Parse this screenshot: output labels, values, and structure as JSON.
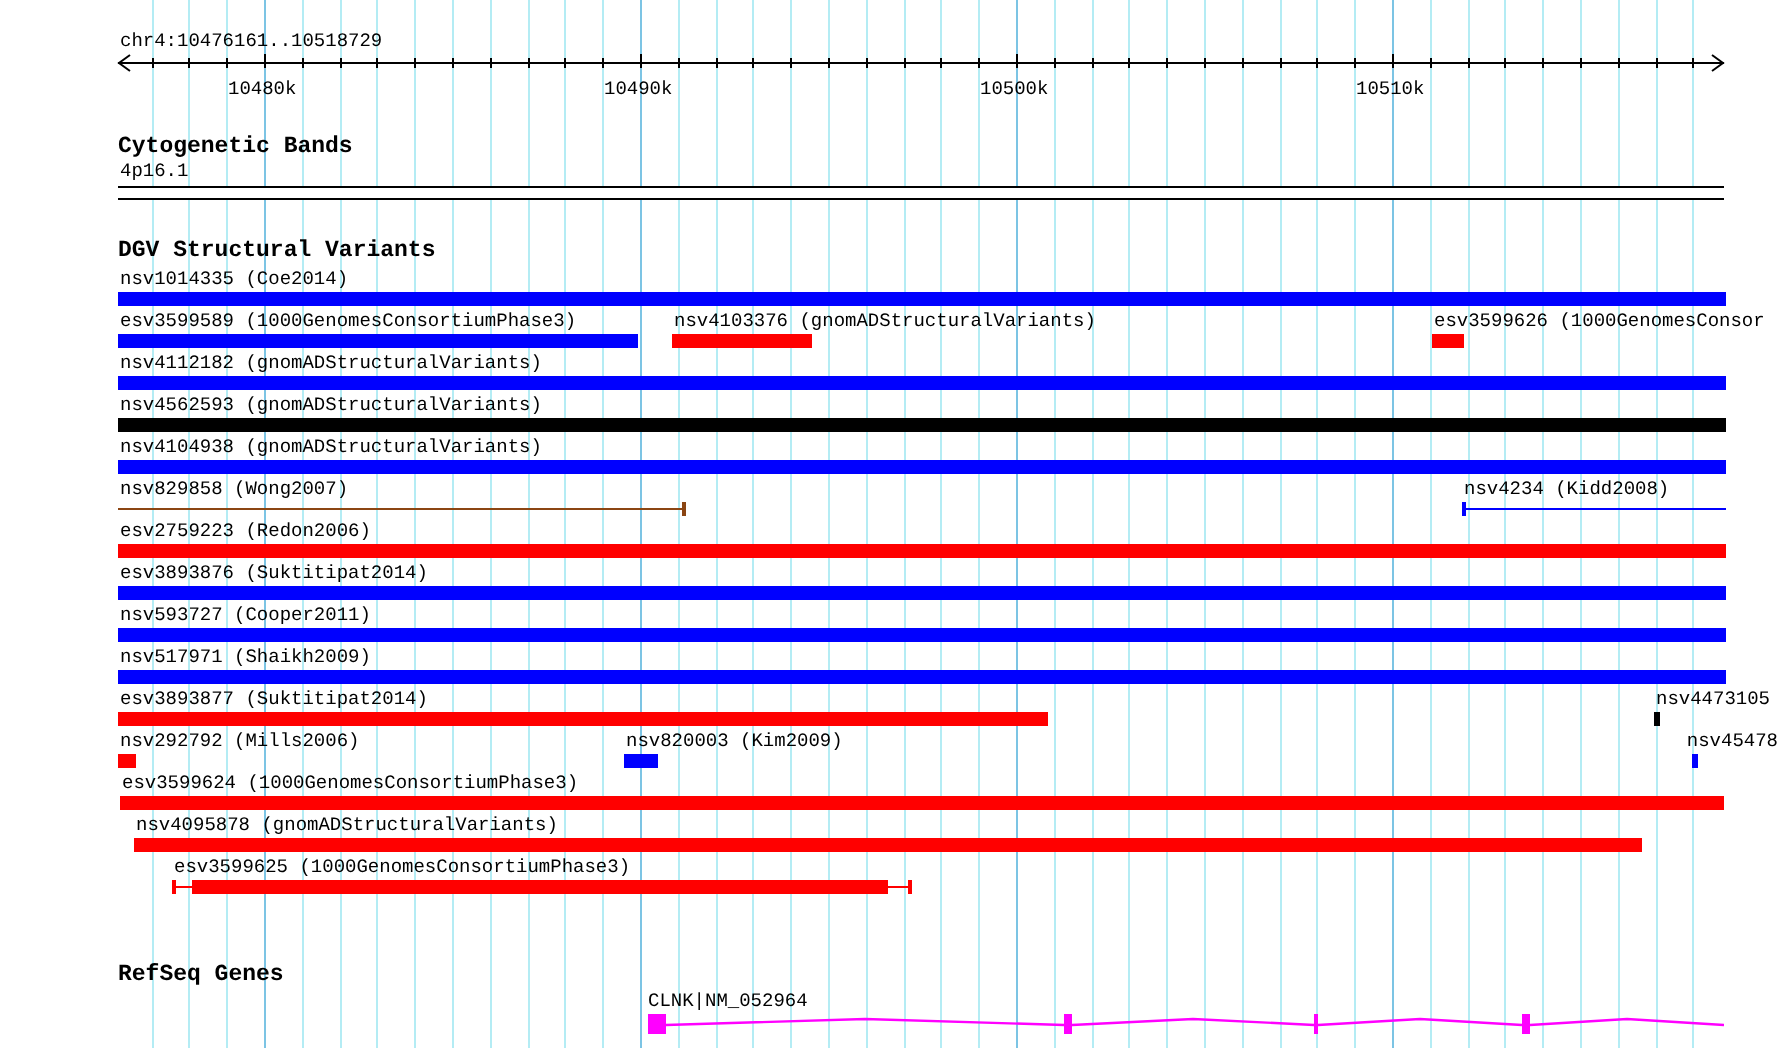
{
  "ruler": {
    "title": "chr4:10476161..10518729",
    "ticks": [
      {
        "label": "10480k"
      },
      {
        "label": "10490k"
      },
      {
        "label": "10500k"
      },
      {
        "label": "10510k"
      }
    ]
  },
  "tracks": [
    {
      "kind": "bands",
      "title": "Cytogenetic Bands",
      "bands": [
        {
          "label": "4p16.1"
        }
      ]
    },
    {
      "kind": "variants",
      "title": "DGV Structural Variants",
      "rows": [
        {
          "features": [
            {
              "label": "nsv1014335 (Coe2014)",
              "kind": "bar",
              "color": "#0000ff"
            }
          ]
        },
        {
          "features": [
            {
              "label": "esv3599589 (1000GenomesConsortiumPhase3)",
              "kind": "bar",
              "color": "#0000ff"
            },
            {
              "label": "nsv4103376 (gnomADStructuralVariants)",
              "kind": "bar",
              "color": "#ff0000"
            },
            {
              "label": "esv3599626 (1000GenomesConsor",
              "kind": "bar",
              "color": "#ff0000"
            }
          ]
        },
        {
          "features": [
            {
              "label": "nsv4112182 (gnomADStructuralVariants)",
              "kind": "bar",
              "color": "#0000ff"
            }
          ]
        },
        {
          "features": [
            {
              "label": "nsv4562593 (gnomADStructuralVariants)",
              "kind": "bar",
              "color": "#000000"
            }
          ]
        },
        {
          "features": [
            {
              "label": "nsv4104938 (gnomADStructuralVariants)",
              "kind": "bar",
              "color": "#0000ff"
            }
          ]
        },
        {
          "features": [
            {
              "label": "nsv829858 (Wong2007)",
              "kind": "line",
              "color": "#8b4513"
            },
            {
              "label": "nsv4234 (Kidd2008)",
              "kind": "line",
              "color": "#0000ff"
            }
          ]
        },
        {
          "features": [
            {
              "label": "esv2759223 (Redon2006)",
              "kind": "bar",
              "color": "#ff0000"
            }
          ]
        },
        {
          "features": [
            {
              "label": "esv3893876 (Suktitipat2014)",
              "kind": "bar",
              "color": "#0000ff"
            }
          ]
        },
        {
          "features": [
            {
              "label": "nsv593727 (Cooper2011)",
              "kind": "bar",
              "color": "#0000ff"
            }
          ]
        },
        {
          "features": [
            {
              "label": "nsv517971 (Shaikh2009)",
              "kind": "bar",
              "color": "#0000ff"
            }
          ]
        },
        {
          "features": [
            {
              "label": "esv3893877 (Suktitipat2014)",
              "kind": "bar",
              "color": "#ff0000"
            },
            {
              "label": "nsv4473105",
              "kind": "bar",
              "color": "#000000"
            }
          ]
        },
        {
          "features": [
            {
              "label": "nsv292792 (Mills2006)",
              "kind": "bar",
              "color": "#ff0000"
            },
            {
              "label": "nsv820003 (Kim2009)",
              "kind": "bar",
              "color": "#0000ff"
            },
            {
              "label": "nsv45478",
              "kind": "bar",
              "color": "#0000ff"
            }
          ]
        },
        {
          "features": [
            {
              "label": "esv3599624 (1000GenomesConsortiumPhase3)",
              "kind": "bar",
              "color": "#ff0000"
            }
          ]
        },
        {
          "features": [
            {
              "label": "nsv4095878 (gnomADStructuralVariants)",
              "kind": "bar",
              "color": "#ff0000"
            }
          ]
        },
        {
          "features": [
            {
              "label": "esv3599625 (1000GenomesConsortiumPhase3)",
              "kind": "bar",
              "color": "#ff0000"
            }
          ]
        }
      ]
    },
    {
      "kind": "genes",
      "title": "RefSeq Genes",
      "genes": [
        {
          "label": "CLNK|NM_052964"
        }
      ]
    }
  ]
}
